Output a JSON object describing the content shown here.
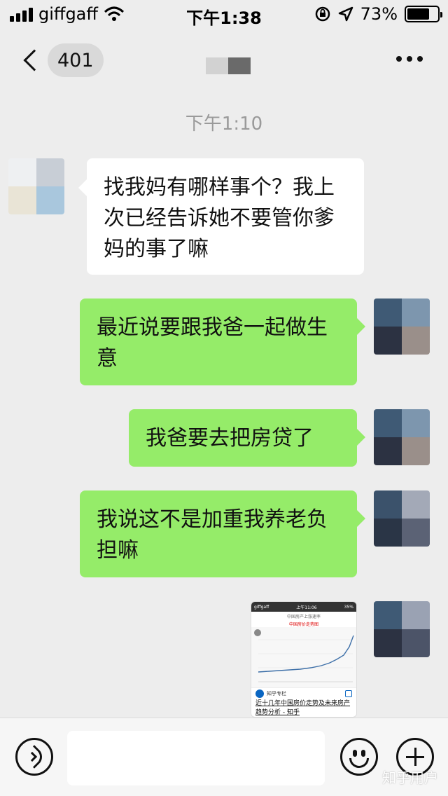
{
  "status_bar": {
    "carrier": "giffgaff",
    "time": "下午1:38",
    "battery_percent": "73%",
    "battery_level": 0.73
  },
  "nav": {
    "unread_count": "401",
    "more_icon": "ellipsis-icon",
    "back_icon": "chevron-left-icon"
  },
  "timestamp": "下午1:10",
  "messages": [
    {
      "side": "in",
      "text": "找我妈有哪样事个？我上次已经告诉她不要管你爹妈的事了嘛"
    },
    {
      "side": "out",
      "text": "最近说要跟我爸一起做生意"
    },
    {
      "side": "out",
      "text": "我爸要去把房贷了"
    },
    {
      "side": "out",
      "text": "我说这不是加重我养老负担嘛"
    }
  ],
  "image_message": {
    "statusbar_carrier": "giffgaff",
    "statusbar_time": "上午11:06",
    "statusbar_battery": "35%",
    "header": "中国房产上涨速率",
    "chart_title": "中国房价走势图",
    "source_name": "知乎专栏",
    "article_title": "近十几年中国房价走势及未来房产趋势分析 - 知乎"
  },
  "input_bar": {
    "placeholder": "",
    "voice_icon": "voice-icon",
    "emoji_icon": "emoji-icon",
    "plus_icon": "plus-icon"
  },
  "watermark": "知乎用户",
  "colors": {
    "background": "#ededed",
    "outgoing_bubble": "#95ec69",
    "incoming_bubble": "#ffffff",
    "timestamp": "#9a9a9a"
  }
}
